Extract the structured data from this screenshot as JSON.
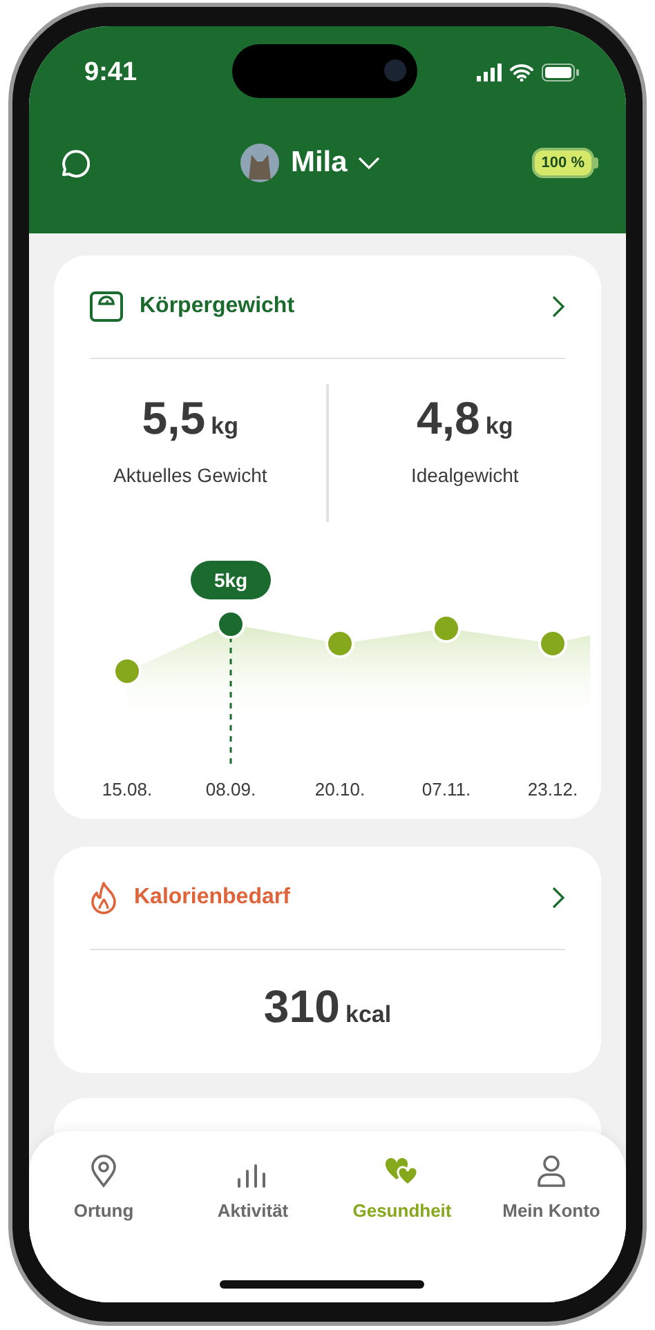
{
  "status_bar": {
    "time": "9:41"
  },
  "header": {
    "pet_name": "Mila",
    "battery": "100 %"
  },
  "weight_card": {
    "title": "Körpergewicht",
    "current": {
      "value": "5,5",
      "unit": "kg",
      "label": "Aktuelles Gewicht"
    },
    "ideal": {
      "value": "4,8",
      "unit": "kg",
      "label": "Idealgewicht"
    },
    "chart": {
      "tooltip": "5kg",
      "points": [
        {
          "date": "15.08.",
          "selected": false
        },
        {
          "date": "08.09.",
          "selected": true
        },
        {
          "date": "20.10.",
          "selected": false
        },
        {
          "date": "07.11.",
          "selected": false
        },
        {
          "date": "23.12.",
          "selected": false
        }
      ]
    }
  },
  "calorie_card": {
    "title": "Kalorienbedarf",
    "value": "310",
    "unit": "kcal"
  },
  "nav": [
    {
      "label": "Ortung",
      "selected": false
    },
    {
      "label": "Aktivität",
      "selected": false
    },
    {
      "label": "Gesundheit",
      "selected": true
    },
    {
      "label": "Mein Konto",
      "selected": false
    }
  ]
}
